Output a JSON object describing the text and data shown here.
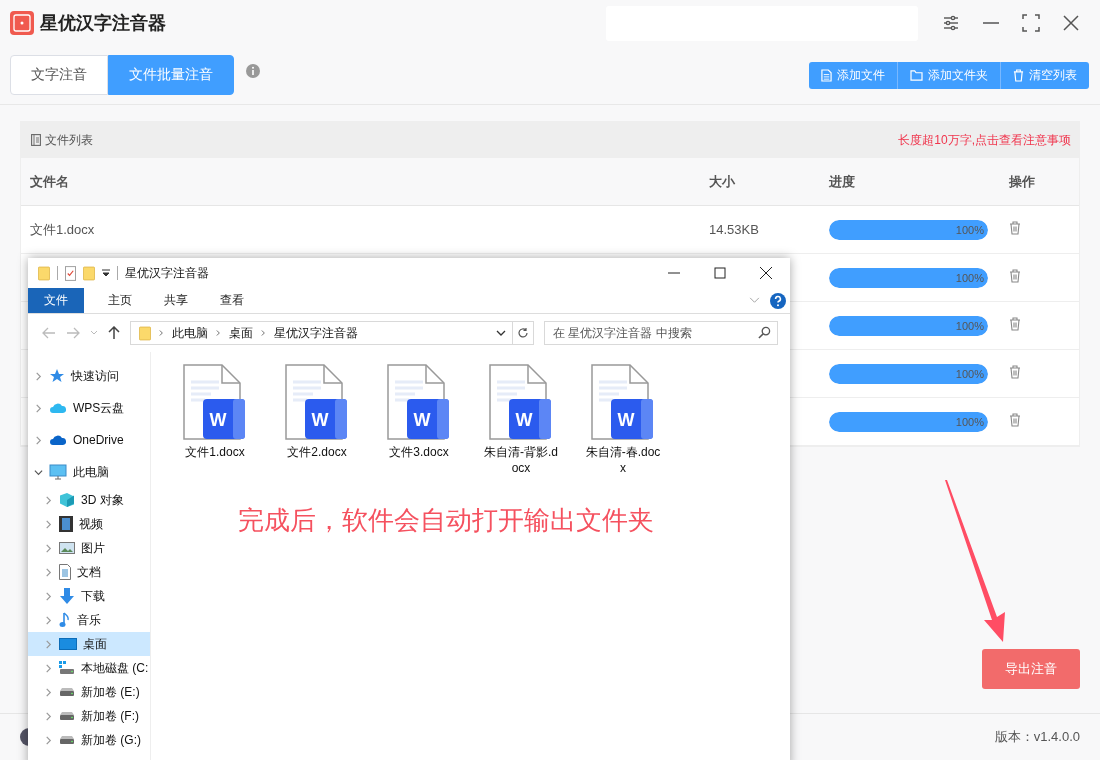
{
  "app": {
    "title": "星优汉字注音器"
  },
  "tabs": [
    {
      "label": "文字注音",
      "selected": false
    },
    {
      "label": "文件批量注音",
      "selected": true
    }
  ],
  "toolbar_buttons": [
    {
      "label": "添加文件",
      "kind": "file"
    },
    {
      "label": "添加文件夹",
      "kind": "folder"
    },
    {
      "label": "清空列表",
      "kind": "trash"
    }
  ],
  "file_list": {
    "title": "文件列表",
    "notice": "长度超10万字,点击查看注意事项",
    "columns": [
      "文件名",
      "大小",
      "进度",
      "操作"
    ],
    "rows": [
      {
        "name": "文件1.docx",
        "size": "14.53KB",
        "level": 1,
        "reading": "100%"
      },
      {
        "level": 1,
        "reading": "100%"
      },
      {
        "level": 1,
        "reading": "100%"
      },
      {
        "level": 1,
        "reading": "100%"
      },
      {
        "level": 1,
        "reading": "100%"
      }
    ]
  },
  "export_button": "导出注音",
  "version": "版本：v1.4.0.0",
  "explorer": {
    "title": "星优汉字注音器",
    "ribbon_tabs": [
      {
        "label": "文件",
        "selected": true
      },
      {
        "label": "主页",
        "selected": false
      },
      {
        "label": "共享",
        "selected": false
      },
      {
        "label": "查看",
        "selected": false
      }
    ],
    "path": [
      "此电脑",
      "桌面",
      "星优汉字注音器"
    ],
    "search": {
      "placeholder": "在 星优汉字注音器 中搜索"
    },
    "nav": [
      {
        "label": "快速访问",
        "kind": "star",
        "expanded": false,
        "selected": false
      },
      {
        "label": "WPS云盘",
        "kind": "cloud",
        "expanded": false,
        "selected": false
      },
      {
        "label": "OneDrive",
        "kind": "onedrive",
        "expanded": false,
        "selected": false
      },
      {
        "label": "此电脑",
        "kind": "pc",
        "expanded": true,
        "selected": false,
        "children": [
          {
            "label": "3D 对象",
            "kind": "cube",
            "expanded": false,
            "selected": false
          },
          {
            "label": "视频",
            "kind": "video",
            "expanded": false,
            "selected": false
          },
          {
            "label": "图片",
            "kind": "picture",
            "expanded": false,
            "selected": false
          },
          {
            "label": "文档",
            "kind": "doc",
            "expanded": false,
            "selected": false
          },
          {
            "label": "下载",
            "kind": "download",
            "expanded": false,
            "selected": false
          },
          {
            "label": "音乐",
            "kind": "music",
            "expanded": false,
            "selected": false
          },
          {
            "label": "桌面",
            "kind": "desktop",
            "expanded": false,
            "selected": true
          },
          {
            "label": "本地磁盘 (C:",
            "kind": "system-drive",
            "expanded": false,
            "selected": false
          },
          {
            "label": "新加卷 (E:)",
            "kind": "drive",
            "expanded": false,
            "selected": false
          },
          {
            "label": "新加卷 (F:)",
            "kind": "drive",
            "expanded": false,
            "selected": false
          },
          {
            "label": "新加卷 (G:)",
            "kind": "drive",
            "expanded": false,
            "selected": false
          }
        ]
      }
    ],
    "files": [
      {
        "name": "文件1.docx",
        "badge": "W"
      },
      {
        "name": "文件2.docx",
        "badge": "W"
      },
      {
        "name": "文件3.docx",
        "badge": "W"
      },
      {
        "name": "朱自清-背影.docx",
        "badge": "W"
      },
      {
        "name": "朱自清-春.docx",
        "badge": "W"
      }
    ]
  },
  "annotation": "完成后，软件会自动打开输出文件夹"
}
